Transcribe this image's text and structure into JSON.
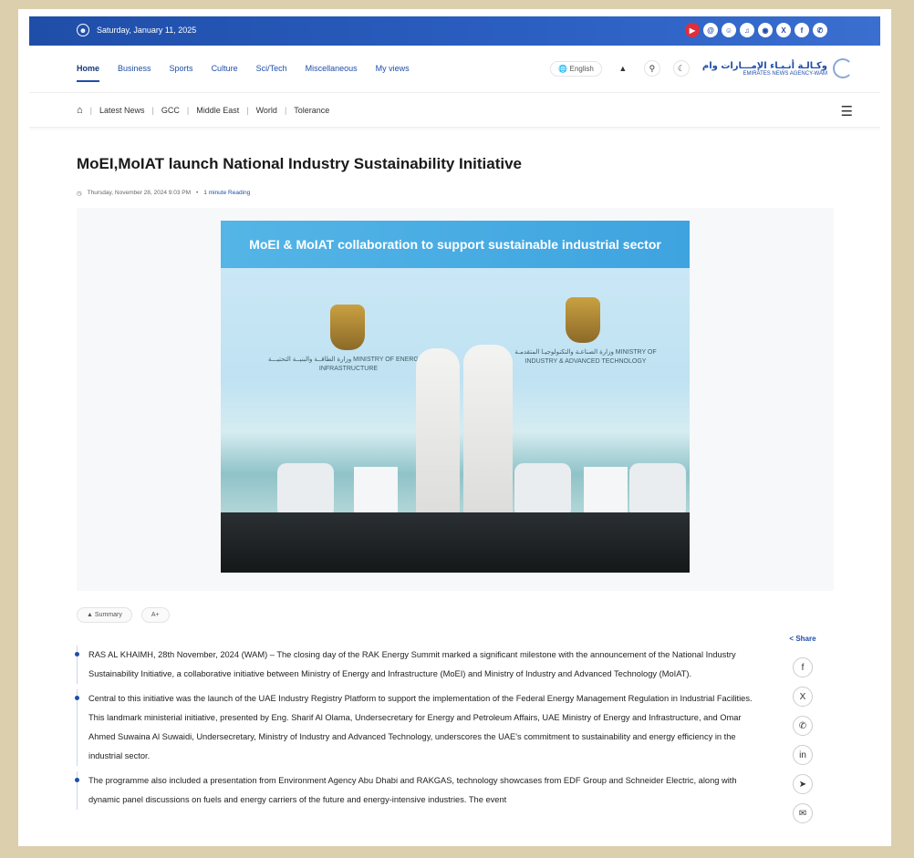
{
  "topbar": {
    "date": "Saturday, January 11, 2025",
    "social_icons": [
      "youtube-icon",
      "threads-icon",
      "snapchat-icon",
      "tiktok-icon",
      "instagram-icon",
      "x-icon",
      "facebook-icon",
      "whatsapp-icon"
    ]
  },
  "nav": {
    "links": [
      "Home",
      "Business",
      "Sports",
      "Culture",
      "Sci/Tech",
      "Miscellaneous",
      "My views"
    ],
    "language": "English",
    "logo_ar": "وكـالـة أنـبـاء الإمـــارات وام",
    "logo_en": "EMIRATES NEWS AGENCY-WAM"
  },
  "subnav": {
    "links": [
      "Latest News",
      "GCC",
      "Middle East",
      "World",
      "Tolerance"
    ]
  },
  "article": {
    "title": "MoEI,MoIAT launch National Industry Sustainability Initiative",
    "date": "Thursday, November 28, 2024 9:03 PM",
    "reading": "1 minute Reading",
    "image": {
      "banner": "MoEI & MoIAT collaboration to support sustainable industrial sector",
      "ministry_left": "وزارة الطاقــة والبنيــة التحتيـــة MINISTRY OF ENERGY & INFRASTRUCTURE",
      "ministry_right": "وزارة الصناعـة والتكنولوجيـا المتقدمـة MINISTRY OF INDUSTRY & ADVANCED TECHNOLOGY"
    },
    "summary_label": "Summary",
    "font_label": "A+",
    "share_label": "Share",
    "share_icons": [
      "facebook-icon",
      "x-icon",
      "whatsapp-icon",
      "linkedin-icon",
      "telegram-icon",
      "email-icon"
    ],
    "paragraphs": [
      "RAS AL KHAIMH, 28th November, 2024 (WAM) – The closing day of the RAK Energy Summit marked a significant milestone with the announcement of the National Industry Sustainability Initiative, a collaborative initiative between Ministry of Energy and Infrastructure (MoEI) and Ministry of Industry and Advanced Technology (MoIAT).",
      "Central to this initiative was the launch of the UAE Industry Registry Platform to support the implementation of the Federal Energy Management Regulation in Industrial Facilities. This landmark ministerial initiative, presented by Eng. Sharif Al Olama, Undersecretary for Energy and Petroleum Affairs, UAE Ministry of Energy and Infrastructure, and Omar Ahmed Suwaina Al Suwaidi, Undersecretary, Ministry of Industry and Advanced Technology, underscores the UAE's commitment to sustainability and energy efficiency in the industrial sector.",
      "The programme also included a presentation from Environment Agency Abu Dhabi and RAKGAS, technology showcases from EDF Group and Schneider Electric, along with dynamic panel discussions on fuels and energy carriers of the future and energy-intensive industries. The event"
    ]
  },
  "colors": {
    "brand_blue": "#1f4ea8",
    "frame_bg": "#dccfae"
  }
}
